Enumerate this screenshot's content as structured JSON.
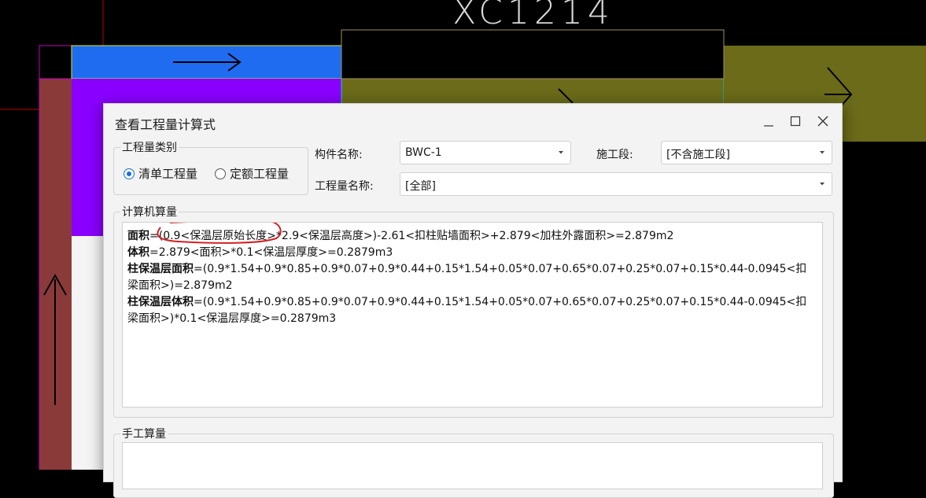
{
  "background_drawing": {
    "label": "XC1214"
  },
  "dialog": {
    "title": "查看工程量计算式",
    "quantity_type": {
      "legend": "工程量类别",
      "options": [
        "清单工程量",
        "定额工程量"
      ],
      "selected": "清单工程量"
    },
    "component_name": {
      "label": "构件名称:",
      "value": "BWC-1"
    },
    "construction_section": {
      "label": "施工段:",
      "value": "[不含施工段]"
    },
    "quantity_name": {
      "label": "工程量名称:",
      "value": "[全部]"
    },
    "computer_calc": {
      "legend": "计算机算量",
      "lines": [
        {
          "name": "面积",
          "expr": "=(0.9<保温层原始长度>*2.9<保温层高度>)-2.61<扣柱贴墙面积>+2.879<加柱外露面积>=2.879m2"
        },
        {
          "name": "体积",
          "expr": "=2.879<面积>*0.1<保温层厚度>=0.2879m3"
        },
        {
          "name": "柱保温层面积",
          "expr": "=(0.9*1.54+0.9*0.85+0.9*0.07+0.9*0.44+0.15*1.54+0.05*0.07+0.65*0.07+0.25*0.07+0.15*0.44-0.0945<扣梁面积>)=2.879m2"
        },
        {
          "name": "柱保温层体积",
          "expr": "=(0.9*1.54+0.9*0.85+0.9*0.07+0.9*0.44+0.15*1.54+0.05*0.07+0.65*0.07+0.25*0.07+0.15*0.44-0.0945<扣梁面积>)*0.1<保温层厚度>=0.2879m3"
        }
      ]
    },
    "manual_calc": {
      "legend": "手工算量",
      "value": ""
    }
  }
}
